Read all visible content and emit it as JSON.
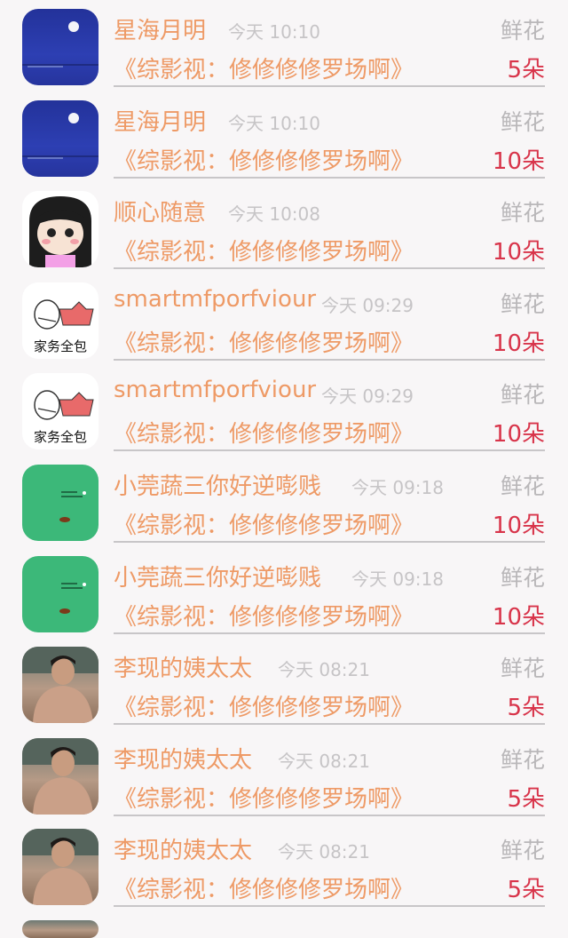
{
  "rows": [
    {
      "name": "星海月明",
      "time": "今天 10:10",
      "gift_label": "鲜花",
      "work": "《综影视：修修修修罗场啊》",
      "count": "5朵",
      "avatar": "night-moon-avatar"
    },
    {
      "name": "星海月明",
      "time": "今天 10:10",
      "gift_label": "鲜花",
      "work": "《综影视：修修修修罗场啊》",
      "count": "10朵",
      "avatar": "night-moon-avatar"
    },
    {
      "name": "顺心随意",
      "time": "今天 10:08",
      "gift_label": "鲜花",
      "work": "《综影视：修修修修罗场啊》",
      "count": "10朵",
      "avatar": "cartoon-girl-avatar"
    },
    {
      "name": "smartmfporfviour",
      "time": "今天 09:29",
      "gift_label": "鲜花",
      "work": "《综影视：修修修修罗场啊》",
      "count": "10朵",
      "avatar": "housework-avatar",
      "avatar_text": "家务全包"
    },
    {
      "name": "smartmfporfviour",
      "time": "今天 09:29",
      "gift_label": "鲜花",
      "work": "《综影视：修修修修罗场啊》",
      "count": "10朵",
      "avatar": "housework-avatar",
      "avatar_text": "家务全包"
    },
    {
      "name": "小莞蔬三你好逆嘭贱",
      "time": "今天 09:18",
      "gift_label": "鲜花",
      "work": "《综影视：修修修修罗场啊》",
      "count": "10朵",
      "avatar": "green-avatar"
    },
    {
      "name": "小莞蔬三你好逆嘭贱",
      "time": "今天 09:18",
      "gift_label": "鲜花",
      "work": "《综影视：修修修修罗场啊》",
      "count": "10朵",
      "avatar": "green-avatar"
    },
    {
      "name": "李现的姨太太",
      "time": "今天 08:21",
      "gift_label": "鲜花",
      "work": "《综影视：修修修修罗场啊》",
      "count": "5朵",
      "avatar": "photo-avatar"
    },
    {
      "name": "李现的姨太太",
      "time": "今天 08:21",
      "gift_label": "鲜花",
      "work": "《综影视：修修修修罗场啊》",
      "count": "5朵",
      "avatar": "photo-avatar"
    },
    {
      "name": "李现的姨太太",
      "time": "今天 08:21",
      "gift_label": "鲜花",
      "work": "《综影视：修修修修罗场啊》",
      "count": "5朵",
      "avatar": "photo-avatar"
    }
  ],
  "colors": {
    "name": "#ee9a66",
    "count": "#d8344a",
    "muted": "#c6c4c6",
    "background": "#f8f6f7"
  }
}
